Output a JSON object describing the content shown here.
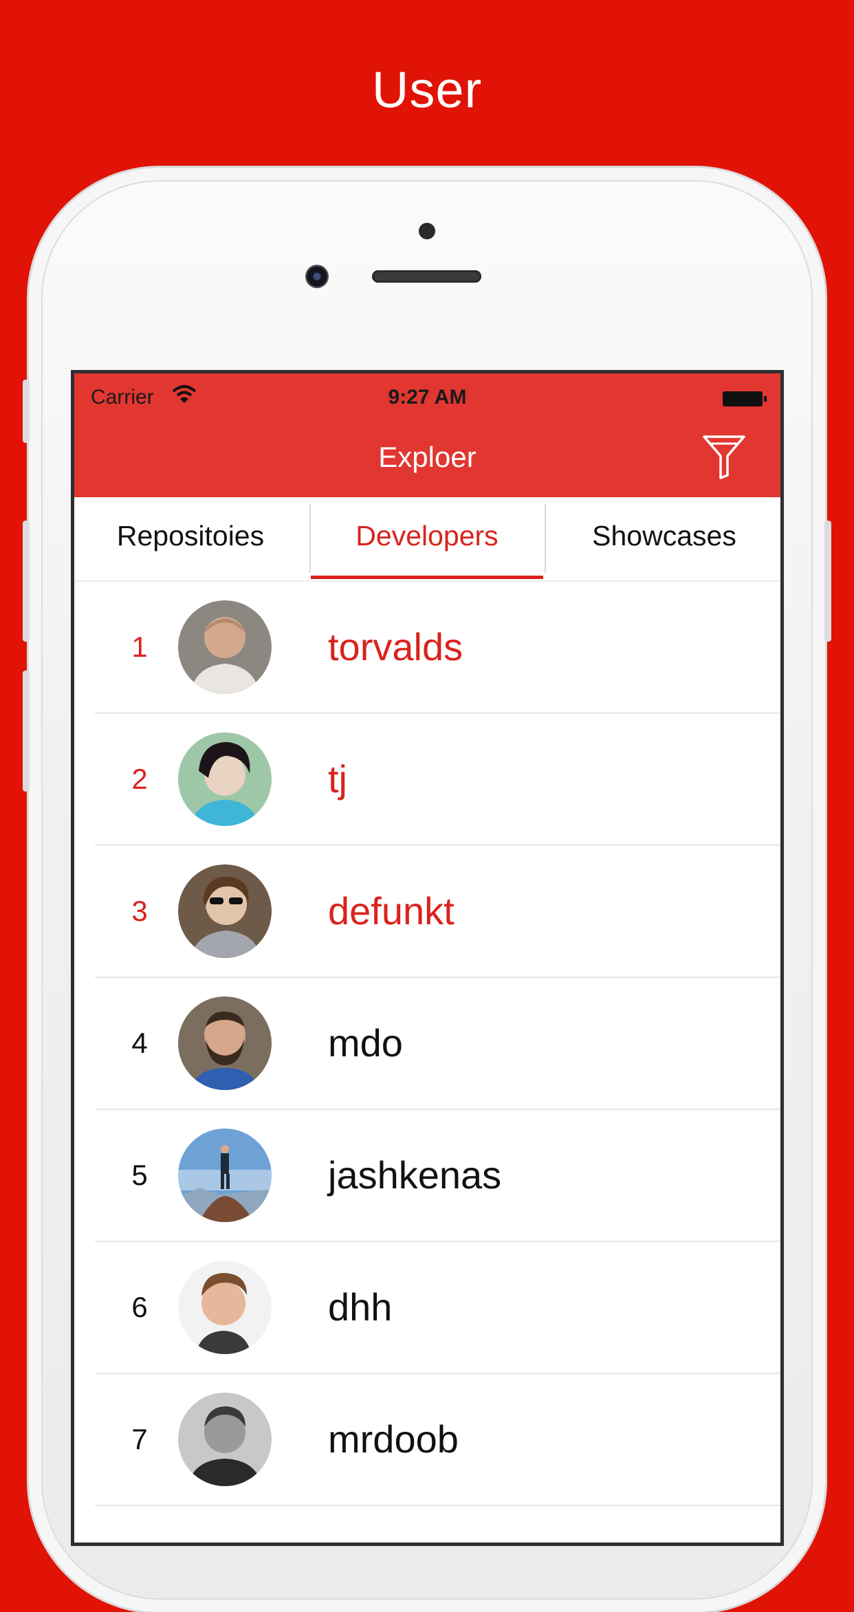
{
  "promo": {
    "title": "User"
  },
  "status_bar": {
    "carrier": "Carrier",
    "time": "9:27 AM"
  },
  "nav": {
    "title": "Exploer",
    "filter_icon": "filter-icon"
  },
  "tabs": [
    {
      "label": "Repositoies",
      "selected": false
    },
    {
      "label": "Developers",
      "selected": true
    },
    {
      "label": "Showcases",
      "selected": false
    }
  ],
  "developers": [
    {
      "rank": "1",
      "name": "torvalds"
    },
    {
      "rank": "2",
      "name": "tj"
    },
    {
      "rank": "3",
      "name": "defunkt"
    },
    {
      "rank": "4",
      "name": "mdo"
    },
    {
      "rank": "5",
      "name": "jashkenas"
    },
    {
      "rank": "6",
      "name": "dhh"
    },
    {
      "rank": "7",
      "name": "mrdoob"
    }
  ],
  "colors": {
    "background": "#e01306",
    "nav_bar": "#e23631",
    "accent": "#d9231d"
  }
}
